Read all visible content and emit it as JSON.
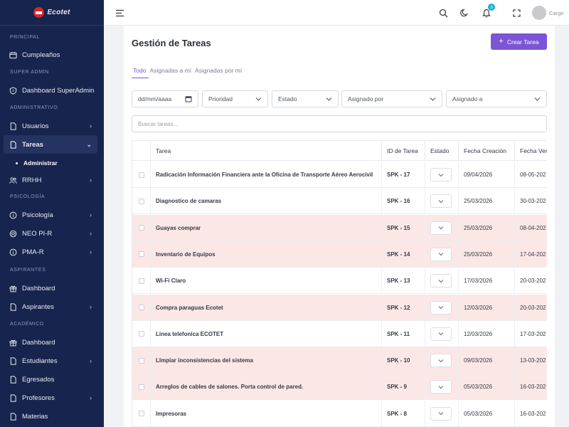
{
  "brand": {
    "name": "Ecotet",
    "accent": "#7b55d6",
    "sidebar_bg": "#17244d"
  },
  "sidebar": {
    "sections": [
      {
        "label": "PRINCIPAL"
      },
      {
        "label": "SUPER ADMIN"
      },
      {
        "label": "ADMINISTRATIVO"
      },
      {
        "label": "PSICOLOGÍA"
      },
      {
        "label": "ASPIRANTES"
      },
      {
        "label": "ACADÉMICO"
      }
    ],
    "items": [
      {
        "label": "Cumpleaños",
        "icon": "calendar-icon"
      },
      {
        "label": "Dashboard SuperAdmin",
        "icon": "shield-icon"
      },
      {
        "label": "Usuarios",
        "icon": "file-icon"
      },
      {
        "label": "Tareas",
        "icon": "file-icon"
      },
      {
        "label": "RRHH",
        "icon": "users-icon"
      },
      {
        "label": "Psicología",
        "icon": "info-circle-icon"
      },
      {
        "label": "NEO PI-R",
        "icon": "brain-icon"
      },
      {
        "label": "PMA-R",
        "icon": "info-circle-icon"
      },
      {
        "label": "Dashboard",
        "icon": "gift-icon"
      },
      {
        "label": "Aspirantes",
        "icon": "file-icon"
      },
      {
        "label": "Dashboard",
        "icon": "gift-icon"
      },
      {
        "label": "Estudiantes",
        "icon": "file-icon"
      },
      {
        "label": "Egresados",
        "icon": "file-icon"
      },
      {
        "label": "Profesores",
        "icon": "file-icon"
      },
      {
        "label": "Materias",
        "icon": "file-icon"
      }
    ],
    "sub_item": "Administrar"
  },
  "topbar": {
    "notification_count": "3",
    "user_role": "Cargo"
  },
  "page": {
    "title": "Gestión de Tareas",
    "create_button": "Crear Tarea",
    "tabs": [
      "Todo",
      "Asignadas a mí",
      "Asignadas por mí"
    ],
    "filters": {
      "date": "dd/mm/aaaa",
      "priority": "Prioridad",
      "status": "Estado",
      "assigned_by": "Asignado por",
      "assigned_to": "Asignado a"
    },
    "search_placeholder": "Buscar tareas..."
  },
  "table": {
    "columns": [
      "Tarea",
      "ID de Tarea",
      "Estado",
      "Fecha Creación",
      "Fecha Ven"
    ],
    "rows": [
      {
        "task": "Radicación Información Financiera ante la Oficina de Transporte Aéreo Aerocivil",
        "id": "SPK - 17",
        "created": "09/04/2026",
        "due": "08-05-202",
        "highlight": false
      },
      {
        "task": "Diagnostico de camaras",
        "id": "SPK - 16",
        "created": "25/03/2026",
        "due": "30-03-202",
        "highlight": false
      },
      {
        "task": "Guayas comprar",
        "id": "SPK - 15",
        "created": "25/03/2026",
        "due": "08-04-202",
        "highlight": true
      },
      {
        "task": "Inventario de Equipos",
        "id": "SPK - 14",
        "created": "25/03/2026",
        "due": "17-04-202",
        "highlight": true
      },
      {
        "task": "Wi-Fi Claro",
        "id": "SPK - 13",
        "created": "17/03/2026",
        "due": "20-03-202",
        "highlight": false
      },
      {
        "task": "Compra paraguas Ecotet",
        "id": "SPK - 12",
        "created": "12/03/2026",
        "due": "20-03-202",
        "highlight": true
      },
      {
        "task": "Linea telefonica ECOTET",
        "id": "SPK - 11",
        "created": "12/03/2026",
        "due": "17-03-202",
        "highlight": false
      },
      {
        "task": "LImpiar inconsistencias del sistema",
        "id": "SPK - 10",
        "created": "09/03/2026",
        "due": "13-03-202",
        "highlight": true
      },
      {
        "task": "Arreglos de cables de salones. Porta control de pared.",
        "id": "SPK - 9",
        "created": "05/03/2026",
        "due": "16-03-202",
        "highlight": true
      },
      {
        "task": "Impresoras",
        "id": "SPK - 8",
        "created": "05/03/2026",
        "due": "16-03-202",
        "highlight": false
      }
    ]
  }
}
